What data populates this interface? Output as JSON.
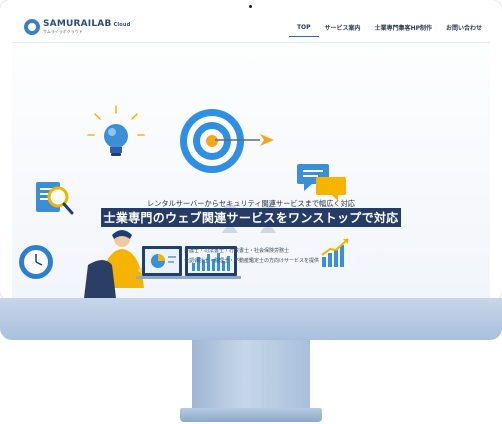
{
  "logo": {
    "name": "SAMURAILAB",
    "suffix": "Cloud",
    "tagline": "サムライラボクラウド"
  },
  "nav": {
    "items": [
      "TOP",
      "サービス案内",
      "士業専門集客HP制作",
      "お問い合わせ"
    ],
    "active": "TOP"
  },
  "hero": {
    "subtitle": "レンタルサーバーからセキュリティ関連サービスまで幅広く対応",
    "title": "士業専門のウェブ関連サービスをワンストップで対応",
    "desc_line1": "弁護士・司法書士・行政書士・社会保険労務士",
    "desc_line2": "公認会計士・税理士・不動産鑑定士の方向けサービスを提供"
  },
  "colors": {
    "accent": "#2b6bd8",
    "brand": "#2b4d82",
    "title_bg": "#253c66",
    "chin": "#b6cbe3"
  },
  "icons": [
    "lightbulb-icon",
    "target-icon",
    "arrow-icon",
    "magnifier-icon",
    "chat-bubbles-icon",
    "clock-icon",
    "growth-chart-icon",
    "laptop-icon",
    "dashboard-icon"
  ]
}
